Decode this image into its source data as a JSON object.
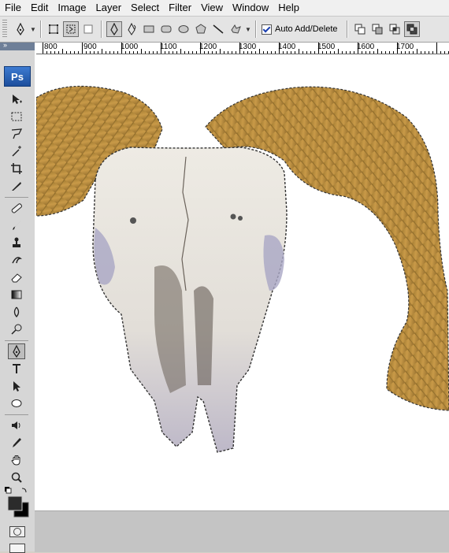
{
  "menu": [
    "File",
    "Edit",
    "Image",
    "Layer",
    "Select",
    "Filter",
    "View",
    "Window",
    "Help"
  ],
  "options_bar": {
    "auto_add_delete_label": "Auto Add/Delete",
    "auto_add_delete_checked": true
  },
  "toolbox": {
    "logo": "Ps",
    "tools": [
      "move-tool",
      "marquee-tool",
      "lasso-tool",
      "magic-wand-tool",
      "crop-tool",
      "slice-tool",
      "healing-brush-tool",
      "brush-tool",
      "clone-stamp-tool",
      "history-brush-tool",
      "eraser-tool",
      "gradient-tool",
      "blur-tool",
      "dodge-tool",
      "pen-tool",
      "type-tool",
      "path-selection-tool",
      "shape-tool",
      "notes-tool",
      "eyedropper-tool",
      "hand-tool",
      "zoom-tool"
    ],
    "active_tool": "pen-tool",
    "foreground_color": "#2b2b2b",
    "background_color": "#000000"
  },
  "ruler": {
    "labels": [
      "800",
      "900",
      "1000",
      "1100",
      "1200",
      "1300",
      "1400",
      "1500",
      "1600",
      "1700"
    ]
  },
  "colors": {
    "horn": "#b58a3a",
    "skull": "#ece8e0",
    "path_stroke": "#3a3a3a"
  }
}
